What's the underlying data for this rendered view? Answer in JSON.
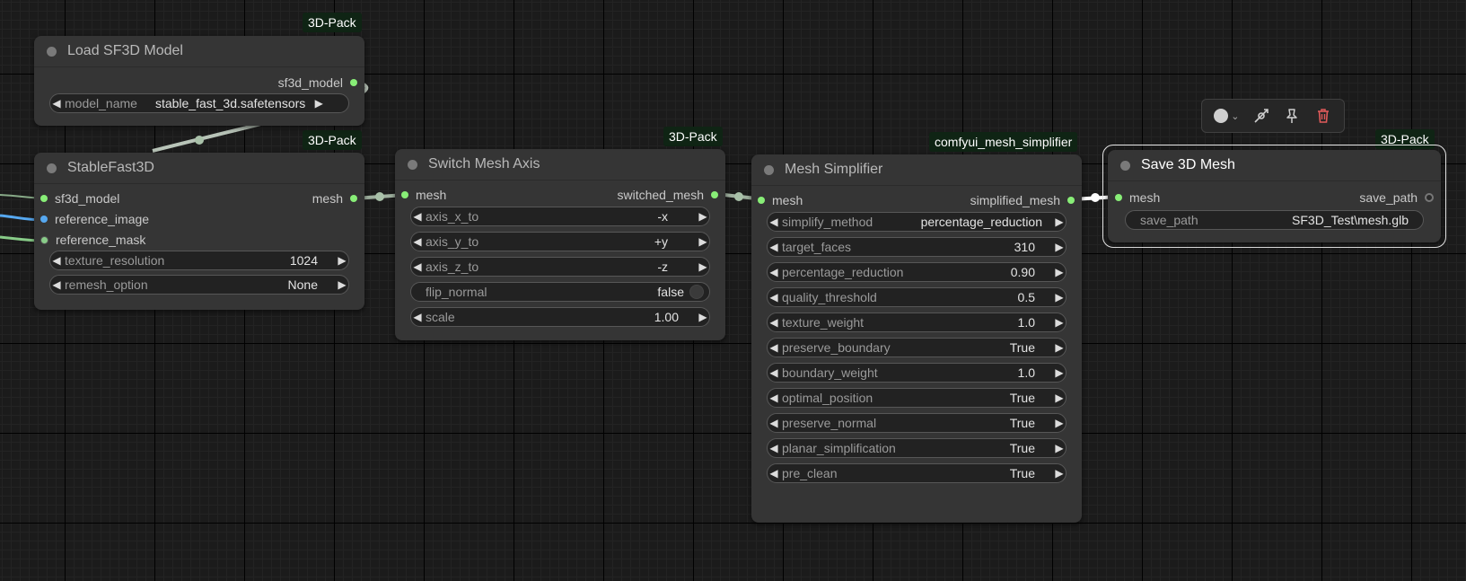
{
  "nodes": {
    "load_sf3d": {
      "title": "Load SF3D Model",
      "badge": "3D-Pack",
      "outputs": [
        "sf3d_model"
      ],
      "widgets": [
        {
          "label": "model_name",
          "value": "stable_fast_3d.safetensors"
        }
      ]
    },
    "stablefast3d": {
      "title": "StableFast3D",
      "badge": "3D-Pack",
      "inputs": [
        "sf3d_model",
        "reference_image",
        "reference_mask"
      ],
      "outputs": [
        "mesh"
      ],
      "widgets": [
        {
          "label": "texture_resolution",
          "value": "1024"
        },
        {
          "label": "remesh_option",
          "value": "None"
        }
      ]
    },
    "switch_axis": {
      "title": "Switch Mesh Axis",
      "badge": "3D-Pack",
      "inputs": [
        "mesh"
      ],
      "outputs": [
        "switched_mesh"
      ],
      "widgets": [
        {
          "label": "axis_x_to",
          "value": "-x"
        },
        {
          "label": "axis_y_to",
          "value": "+y"
        },
        {
          "label": "axis_z_to",
          "value": "-z"
        },
        {
          "label": "flip_normal",
          "value": "false"
        },
        {
          "label": "scale",
          "value": "1.00"
        }
      ]
    },
    "mesh_simplifier": {
      "title": "Mesh Simplifier",
      "badge": "comfyui_mesh_simplifier",
      "inputs": [
        "mesh"
      ],
      "outputs": [
        "simplified_mesh"
      ],
      "widgets": [
        {
          "label": "simplify_method",
          "value": "percentage_reduction"
        },
        {
          "label": "target_faces",
          "value": "310"
        },
        {
          "label": "percentage_reduction",
          "value": "0.90"
        },
        {
          "label": "quality_threshold",
          "value": "0.5"
        },
        {
          "label": "texture_weight",
          "value": "1.0"
        },
        {
          "label": "preserve_boundary",
          "value": "True"
        },
        {
          "label": "boundary_weight",
          "value": "1.0"
        },
        {
          "label": "optimal_position",
          "value": "True"
        },
        {
          "label": "preserve_normal",
          "value": "True"
        },
        {
          "label": "planar_simplification",
          "value": "True"
        },
        {
          "label": "pre_clean",
          "value": "True"
        }
      ]
    },
    "save_mesh": {
      "title": "Save 3D Mesh",
      "badge": "3D-Pack",
      "inputs": [
        "mesh"
      ],
      "outputs": [
        "save_path"
      ],
      "widgets": [
        {
          "label": "save_path",
          "value": "SF3D_Test\\mesh.glb"
        }
      ]
    }
  },
  "toolbar": {
    "icons": [
      "color-circle-icon",
      "chevron-down-icon",
      "bypass-icon",
      "pin-icon",
      "trash-icon"
    ]
  },
  "colors": {
    "canvas": "#1b1b1b",
    "node_body": "#353535",
    "badge_bg": "#0f2414",
    "slot_mesh": "#88ee77",
    "slot_image": "#56a8f0",
    "delete": "#e05a5a"
  }
}
